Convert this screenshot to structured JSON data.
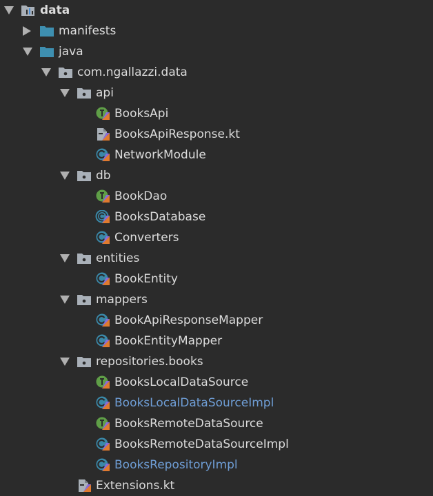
{
  "tree": [
    {
      "label": "data",
      "icon": "module-folder-icon",
      "arrow": "down",
      "depth": 0,
      "color": "#dcdcdc"
    },
    {
      "label": "manifests",
      "icon": "folder-icon",
      "arrow": "right",
      "depth": 1,
      "color": "#dcdcdc"
    },
    {
      "label": "java",
      "icon": "folder-icon",
      "arrow": "down",
      "depth": 1,
      "color": "#dcdcdc"
    },
    {
      "label": "com.ngallazzi.data",
      "icon": "package-icon",
      "arrow": "down",
      "depth": 2,
      "color": "#dcdcdc"
    },
    {
      "label": "api",
      "icon": "package-icon",
      "arrow": "down",
      "depth": 3,
      "color": "#dcdcdc"
    },
    {
      "label": "BooksApi",
      "icon": "kotlin-interface-icon",
      "arrow": "none",
      "depth": 4,
      "color": "#dcdcdc"
    },
    {
      "label": "BooksApiResponse.kt",
      "icon": "kotlin-file-icon",
      "arrow": "none",
      "depth": 4,
      "color": "#dcdcdc"
    },
    {
      "label": "NetworkModule",
      "icon": "kotlin-class-icon",
      "arrow": "none",
      "depth": 4,
      "color": "#dcdcdc"
    },
    {
      "label": "db",
      "icon": "package-icon",
      "arrow": "down",
      "depth": 3,
      "color": "#dcdcdc"
    },
    {
      "label": "BookDao",
      "icon": "kotlin-interface-icon",
      "arrow": "none",
      "depth": 4,
      "color": "#dcdcdc"
    },
    {
      "label": "BooksDatabase",
      "icon": "kotlin-abstract-class-icon",
      "arrow": "none",
      "depth": 4,
      "color": "#dcdcdc"
    },
    {
      "label": "Converters",
      "icon": "kotlin-class-icon",
      "arrow": "none",
      "depth": 4,
      "color": "#dcdcdc"
    },
    {
      "label": "entities",
      "icon": "package-icon",
      "arrow": "down",
      "depth": 3,
      "color": "#dcdcdc"
    },
    {
      "label": "BookEntity",
      "icon": "kotlin-class-icon",
      "arrow": "none",
      "depth": 4,
      "color": "#dcdcdc"
    },
    {
      "label": "mappers",
      "icon": "package-icon",
      "arrow": "down",
      "depth": 3,
      "color": "#dcdcdc"
    },
    {
      "label": "BookApiResponseMapper",
      "icon": "kotlin-class-icon",
      "arrow": "none",
      "depth": 4,
      "color": "#dcdcdc"
    },
    {
      "label": "BookEntityMapper",
      "icon": "kotlin-class-icon",
      "arrow": "none",
      "depth": 4,
      "color": "#dcdcdc"
    },
    {
      "label": "repositories.books",
      "icon": "package-icon",
      "arrow": "down",
      "depth": 3,
      "color": "#dcdcdc"
    },
    {
      "label": "BooksLocalDataSource",
      "icon": "kotlin-interface-icon",
      "arrow": "none",
      "depth": 4,
      "color": "#dcdcdc"
    },
    {
      "label": "BooksLocalDataSourceImpl",
      "icon": "kotlin-class-icon",
      "arrow": "none",
      "depth": 4,
      "color": "#6f9ed6"
    },
    {
      "label": "BooksRemoteDataSource",
      "icon": "kotlin-interface-icon",
      "arrow": "none",
      "depth": 4,
      "color": "#dcdcdc"
    },
    {
      "label": "BooksRemoteDataSourceImpl",
      "icon": "kotlin-class-icon",
      "arrow": "none",
      "depth": 4,
      "color": "#dcdcdc"
    },
    {
      "label": "BooksRepositoryImpl",
      "icon": "kotlin-class-icon",
      "arrow": "none",
      "depth": 4,
      "color": "#6f9ed6"
    },
    {
      "label": "Extensions.kt",
      "icon": "kotlin-file-icon",
      "arrow": "none",
      "depth": 3,
      "color": "#dcdcdc"
    }
  ]
}
